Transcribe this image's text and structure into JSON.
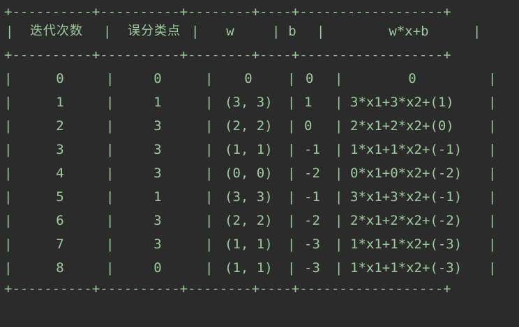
{
  "table": {
    "border_top": "+----------+----------+--------+----+------------------+",
    "border_mid": "+----------+----------+--------+----+------------------+",
    "border_bottom": "+----------+----------+--------+----+------------------+",
    "headers": [
      "迭代次数",
      "误分类点",
      "w",
      "b",
      "w*x+b"
    ],
    "rows": [
      [
        "0",
        "0",
        "0",
        "0",
        "0"
      ],
      [
        "1",
        "1",
        "(3, 3)",
        "1",
        "3*x1+3*x2+(1)"
      ],
      [
        "2",
        "3",
        "(2, 2)",
        "0",
        "2*x1+2*x2+(0)"
      ],
      [
        "3",
        "3",
        "(1, 1)",
        "-1",
        "1*x1+1*x2+(-1)"
      ],
      [
        "4",
        "3",
        "(0, 0)",
        "-2",
        "0*x1+0*x2+(-2)"
      ],
      [
        "5",
        "1",
        "(3, 3)",
        "-1",
        "3*x1+3*x2+(-1)"
      ],
      [
        "6",
        "3",
        "(2, 2)",
        "-2",
        "2*x1+2*x2+(-2)"
      ],
      [
        "7",
        "3",
        "(1, 1)",
        "-3",
        "1*x1+1*x2+(-3)"
      ],
      [
        "8",
        "0",
        "(1, 1)",
        "-3",
        "1*x1+1*x2+(-3)"
      ]
    ]
  },
  "colors": {
    "background": "#2b2b2b",
    "text": "#9ecb9e"
  }
}
